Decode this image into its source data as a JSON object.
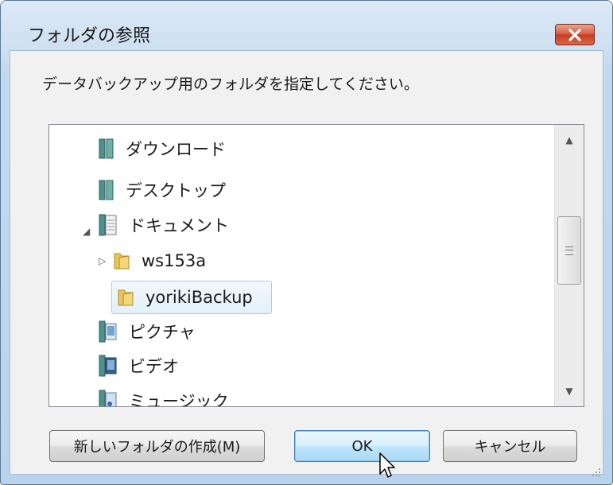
{
  "window": {
    "title": "フォルダの参照"
  },
  "instruction": "データバックアップ用のフォルダを指定してください。",
  "tree": {
    "items": [
      {
        "label": "ダウンロード",
        "icon": "library-icon"
      },
      {
        "label": "デスクトップ",
        "icon": "library-icon"
      },
      {
        "label": "ドキュメント",
        "icon": "documents-library-icon",
        "expanded": true
      },
      {
        "label": "ws153a",
        "icon": "folder-icon",
        "collapsed": true
      },
      {
        "label": "yorikiBackup",
        "icon": "folder-icon",
        "selected": true
      },
      {
        "label": "ピクチャ",
        "icon": "pictures-library-icon"
      },
      {
        "label": "ビデオ",
        "icon": "videos-library-icon"
      },
      {
        "label": "ミュージック",
        "icon": "music-library-icon"
      }
    ]
  },
  "buttons": {
    "new_folder": "新しいフォルダの作成(M)",
    "ok": "OK",
    "cancel": "キャンセル"
  }
}
